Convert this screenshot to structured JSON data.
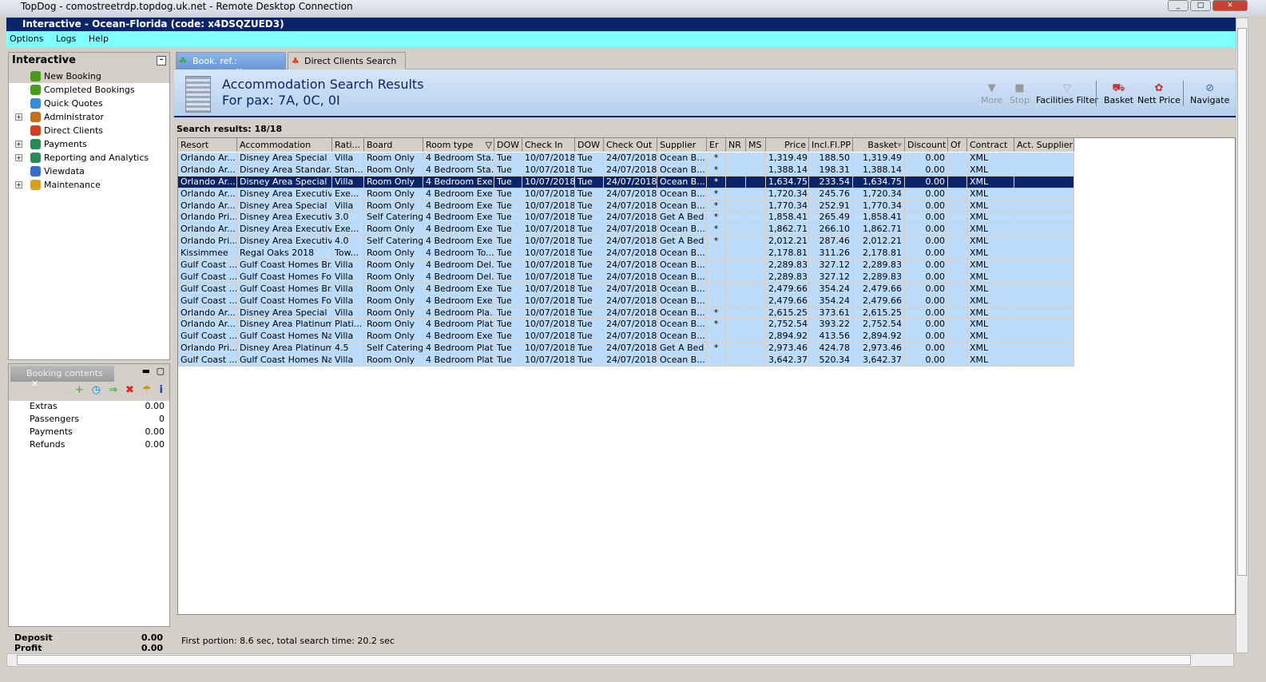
{
  "rdp_title": "TopDog - comostreetrdp.topdog.uk.net - Remote Desktop Connection",
  "app_title": "Interactive - Ocean-Florida (code: x4DSQZUED3)",
  "menu": [
    "Options",
    "Logs",
    "Help"
  ],
  "left": {
    "title": "Interactive",
    "items": [
      {
        "label": "New Booking",
        "color": "#4a9a20",
        "expand": false
      },
      {
        "label": "Completed Bookings",
        "color": "#4a9a20",
        "expand": false
      },
      {
        "label": "Quick Quotes",
        "color": "#3a8ad8",
        "expand": false
      },
      {
        "label": "Administrator",
        "color": "#c07020",
        "expand": true
      },
      {
        "label": "Direct Clients",
        "color": "#d04020",
        "expand": false
      },
      {
        "label": "Payments",
        "color": "#2a8a5a",
        "expand": true
      },
      {
        "label": "Reporting and Analytics",
        "color": "#2a8a5a",
        "expand": true
      },
      {
        "label": "Viewdata",
        "color": "#3a6ac8",
        "expand": false
      },
      {
        "label": "Maintenance",
        "color": "#d8a020",
        "expand": true
      }
    ]
  },
  "booking": {
    "tab": "Booking contents",
    "tools": [
      "+",
      "◷",
      "⇒",
      "✖",
      "☂",
      "i"
    ],
    "rows": [
      {
        "k": "Extras",
        "v": "0.00"
      },
      {
        "k": "Passengers",
        "v": "0"
      },
      {
        "k": "Payments",
        "v": "0.00"
      },
      {
        "k": "Refunds",
        "v": "0.00"
      }
    ],
    "totals": [
      {
        "k": "Deposit",
        "v": "0.00"
      },
      {
        "k": "Profit",
        "v": "0.00"
      }
    ]
  },
  "tabs": [
    "Book. ref.: <none>",
    "Direct Clients Search"
  ],
  "header": {
    "title": "Accommodation Search Results",
    "pax": "For pax: 7A, 0C, 0I"
  },
  "toolbar": [
    "More",
    "Stop",
    "Facilities Filter",
    "Basket",
    "Nett Price",
    "Navigate"
  ],
  "results_label": "Search results: 18/18",
  "columns": [
    "Resort",
    "Accommodation",
    "Rati...",
    "Board",
    "Room type",
    "DOW",
    "Check In",
    "DOW",
    "Check Out",
    "Supplier",
    "Er",
    "NR",
    "MS",
    "Price",
    "Incl.Fl.PP",
    "Basket",
    "Discount",
    "Of",
    "Contract",
    "Act. Supplier"
  ],
  "rows": [
    [
      "Orlando Ar...",
      "Disney Area Special",
      "Villa",
      "Room Only",
      "4 Bedroom Sta...",
      "Tue",
      "10/07/2018",
      "Tue",
      "24/07/2018",
      "Ocean B...",
      "*",
      "",
      "",
      "1,319.49",
      "188.50",
      "1,319.49",
      "0.00",
      "",
      "XML",
      ""
    ],
    [
      "Orlando Ar...",
      "Disney Area Standar...",
      "Stan...",
      "Room Only",
      "4 Bedroom Sta...",
      "Tue",
      "10/07/2018",
      "Tue",
      "24/07/2018",
      "Ocean B...",
      "*",
      "",
      "",
      "1,388.14",
      "198.31",
      "1,388.14",
      "0.00",
      "",
      "XML",
      ""
    ],
    [
      "Orlando Ar...",
      "Disney Area Special",
      "Villa",
      "Room Only",
      "4 Bedroom Exe...",
      "Tue",
      "10/07/2018",
      "Tue",
      "24/07/2018",
      "Ocean B...",
      "*",
      "",
      "",
      "1,634.75",
      "233.54",
      "1,634.75",
      "0.00",
      "",
      "XML",
      ""
    ],
    [
      "Orlando Ar...",
      "Disney Area Executiv...",
      "Exe...",
      "Room Only",
      "4 Bedroom Exe...",
      "Tue",
      "10/07/2018",
      "Tue",
      "24/07/2018",
      "Ocean B...",
      "*",
      "",
      "",
      "1,720.34",
      "245.76",
      "1,720.34",
      "0.00",
      "",
      "XML",
      ""
    ],
    [
      "Orlando Ar...",
      "Disney Area Special",
      "Villa",
      "Room Only",
      "4 Bedroom Exe...",
      "Tue",
      "10/07/2018",
      "Tue",
      "24/07/2018",
      "Ocean B...",
      "*",
      "",
      "",
      "1,770.34",
      "252.91",
      "1,770.34",
      "0.00",
      "",
      "XML",
      ""
    ],
    [
      "Orlando Pri...",
      "Disney Area Executiv...",
      "3.0",
      "Self Catering",
      "4 Bedroom Exe...",
      "Tue",
      "10/07/2018",
      "Tue",
      "24/07/2018",
      "Get A Bed",
      "*",
      "",
      "",
      "1,858.41",
      "265.49",
      "1,858.41",
      "0.00",
      "",
      "XML",
      ""
    ],
    [
      "Orlando Ar...",
      "Disney Area Executiv...",
      "Exe...",
      "Room Only",
      "4 Bedroom Exe...",
      "Tue",
      "10/07/2018",
      "Tue",
      "24/07/2018",
      "Ocean B...",
      "*",
      "",
      "",
      "1,862.71",
      "266.10",
      "1,862.71",
      "0.00",
      "",
      "XML",
      ""
    ],
    [
      "Orlando Pri...",
      "Disney Area Executiv...",
      "4.0",
      "Self Catering",
      "4 Bedroom Exe...",
      "Tue",
      "10/07/2018",
      "Tue",
      "24/07/2018",
      "Get A Bed",
      "*",
      "",
      "",
      "2,012.21",
      "287.46",
      "2,012.21",
      "0.00",
      "",
      "XML",
      ""
    ],
    [
      "Kissimmee",
      "Regal Oaks 2018",
      "Tow...",
      "Room Only",
      "4 Bedroom To...",
      "Tue",
      "10/07/2018",
      "Tue",
      "24/07/2018",
      "Ocean B...",
      "",
      "",
      "",
      "2,178.81",
      "311.26",
      "2,178.81",
      "0.00",
      "",
      "XML",
      ""
    ],
    [
      "Gulf Coast ...",
      "Gulf Coast Homes Br...",
      "Villa",
      "Room Only",
      "4 Bedroom Del...",
      "Tue",
      "10/07/2018",
      "Tue",
      "24/07/2018",
      "Ocean B...",
      "",
      "",
      "",
      "2,289.83",
      "327.12",
      "2,289.83",
      "0.00",
      "",
      "XML",
      ""
    ],
    [
      "Gulf Coast ...",
      "Gulf Coast Homes Fo...",
      "Villa",
      "Room Only",
      "4 Bedroom Del...",
      "Tue",
      "10/07/2018",
      "Tue",
      "24/07/2018",
      "Ocean B...",
      "",
      "",
      "",
      "2,289.83",
      "327.12",
      "2,289.83",
      "0.00",
      "",
      "XML",
      ""
    ],
    [
      "Gulf Coast ...",
      "Gulf Coast Homes Br...",
      "Villa",
      "Room Only",
      "4 Bedroom Exe...",
      "Tue",
      "10/07/2018",
      "Tue",
      "24/07/2018",
      "Ocean B...",
      "",
      "",
      "",
      "2,479.66",
      "354.24",
      "2,479.66",
      "0.00",
      "",
      "XML",
      ""
    ],
    [
      "Gulf Coast ...",
      "Gulf Coast Homes Fo...",
      "Villa",
      "Room Only",
      "4 Bedroom Exe...",
      "Tue",
      "10/07/2018",
      "Tue",
      "24/07/2018",
      "Ocean B...",
      "",
      "",
      "",
      "2,479.66",
      "354.24",
      "2,479.66",
      "0.00",
      "",
      "XML",
      ""
    ],
    [
      "Orlando Ar...",
      "Disney Area Special",
      "Villa",
      "Room Only",
      "4 Bedroom Pla...",
      "Tue",
      "10/07/2018",
      "Tue",
      "24/07/2018",
      "Ocean B...",
      "*",
      "",
      "",
      "2,615.25",
      "373.61",
      "2,615.25",
      "0.00",
      "",
      "XML",
      ""
    ],
    [
      "Orlando Ar...",
      "Disney Area Platinum...",
      "Plati...",
      "Room Only",
      "4 Bedroom Plat...",
      "Tue",
      "10/07/2018",
      "Tue",
      "24/07/2018",
      "Ocean B...",
      "*",
      "",
      "",
      "2,752.54",
      "393.22",
      "2,752.54",
      "0.00",
      "",
      "XML",
      ""
    ],
    [
      "Gulf Coast ...",
      "Gulf Coast Homes Na...",
      "Villa",
      "Room Only",
      "4 Bedroom Exe...",
      "Tue",
      "10/07/2018",
      "Tue",
      "24/07/2018",
      "Ocean B...",
      "",
      "",
      "",
      "2,894.92",
      "413.56",
      "2,894.92",
      "0.00",
      "",
      "XML",
      ""
    ],
    [
      "Orlando Pri...",
      "Disney Area Platinum...",
      "4.5",
      "Self Catering",
      "4 Bedroom Plat...",
      "Tue",
      "10/07/2018",
      "Tue",
      "24/07/2018",
      "Get A Bed",
      "*",
      "",
      "",
      "2,973.46",
      "424.78",
      "2,973.46",
      "0.00",
      "",
      "XML",
      ""
    ],
    [
      "Gulf Coast ...",
      "Gulf Coast Homes Na...",
      "Villa",
      "Room Only",
      "4 Bedroom Plat...",
      "Tue",
      "10/07/2018",
      "Tue",
      "24/07/2018",
      "Ocean B...",
      "",
      "",
      "",
      "3,642.37",
      "520.34",
      "3,642.37",
      "0.00",
      "",
      "XML",
      ""
    ]
  ],
  "selected_row": 2,
  "status": "First portion: 8.6 sec, total search time: 20.2 sec"
}
